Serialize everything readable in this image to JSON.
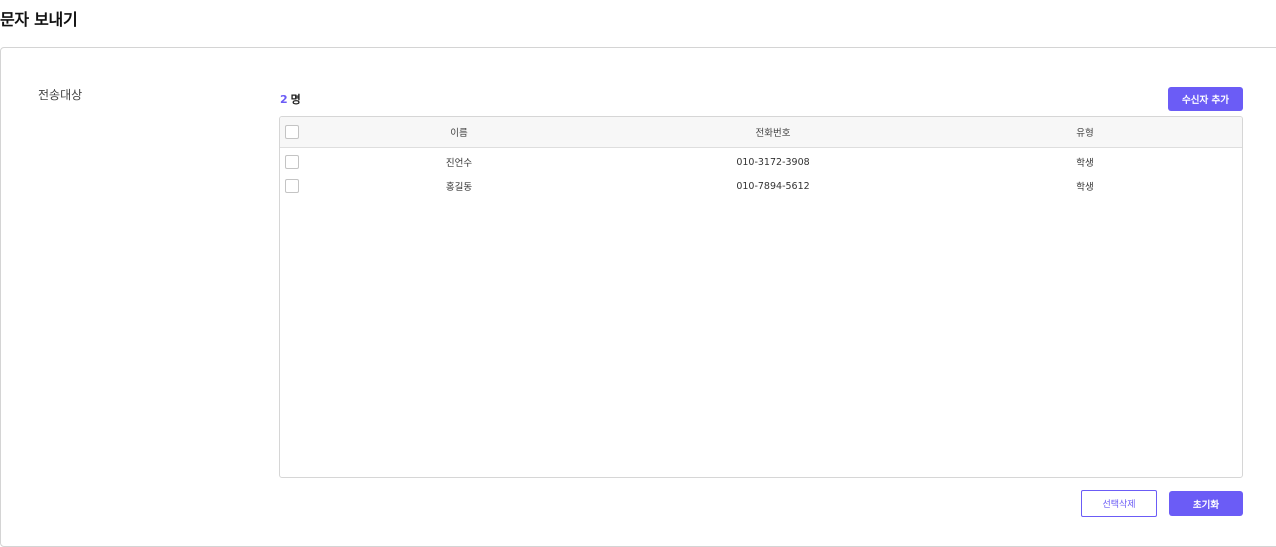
{
  "page": {
    "title": "문자 보내기"
  },
  "form": {
    "recipients_label": "전송대상"
  },
  "summary": {
    "count": "2",
    "unit": "명"
  },
  "actions": {
    "add_recipient": "수신자 추가",
    "delete_selected": "선택삭제",
    "reset": "초기화"
  },
  "table": {
    "headers": {
      "name": "이름",
      "phone": "전화번호",
      "type": "유형"
    },
    "rows": [
      {
        "name": "진언수",
        "phone": "010-3172-3908",
        "type": "학생"
      },
      {
        "name": "홍길동",
        "phone": "010-7894-5612",
        "type": "학생"
      }
    ]
  },
  "colors": {
    "accent": "#6b5cf6",
    "border": "#d6d6d6",
    "header_bg": "#f7f7f7"
  }
}
